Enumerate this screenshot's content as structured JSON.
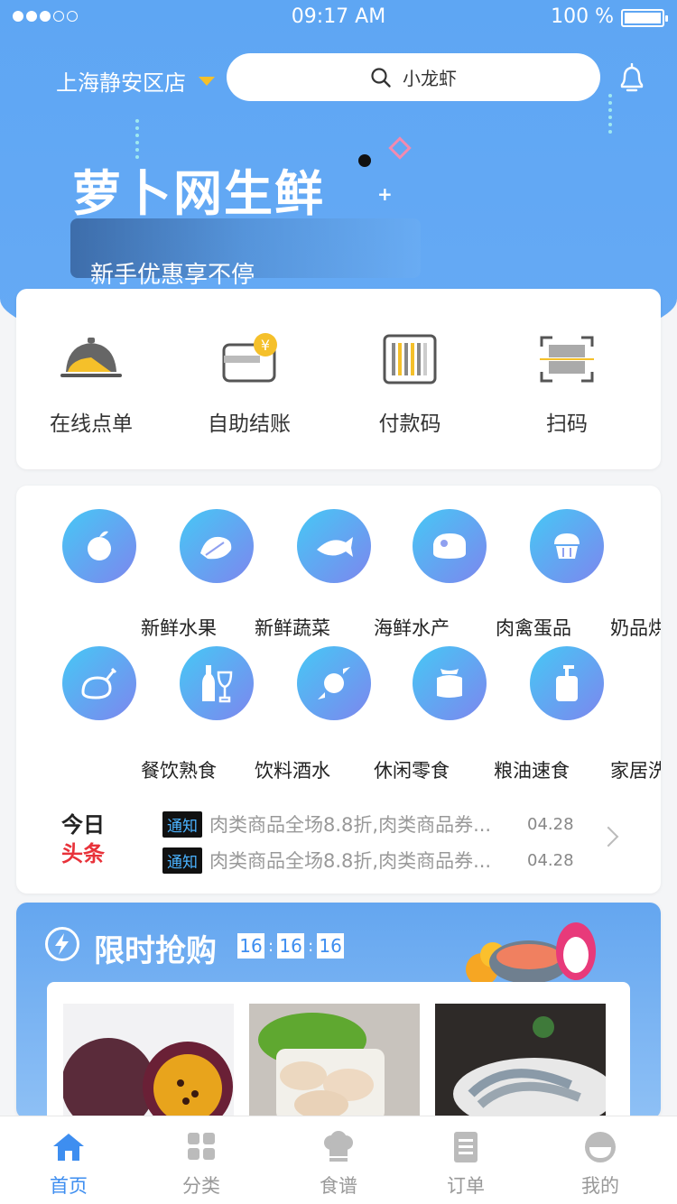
{
  "status_bar": {
    "time": "09:17 AM",
    "battery": "100 %"
  },
  "header": {
    "store_name": "上海静安区店",
    "search_text": "小龙虾"
  },
  "banner": {
    "title": "萝卜网生鲜",
    "subtitle": "新手优惠享不停"
  },
  "services": [
    {
      "label": "在线点单",
      "icon": "cloche-icon"
    },
    {
      "label": "自助结账",
      "icon": "yen-card-icon"
    },
    {
      "label": "付款码",
      "icon": "barcode-icon"
    },
    {
      "label": "扫码",
      "icon": "scan-icon"
    }
  ],
  "categories": [
    {
      "label": "新鲜水果",
      "icon": "fruit-icon"
    },
    {
      "label": "新鲜蔬菜",
      "icon": "vegetable-icon"
    },
    {
      "label": "海鲜水产",
      "icon": "fish-icon"
    },
    {
      "label": "肉禽蛋品",
      "icon": "meat-icon"
    },
    {
      "label": "奶品烘焙",
      "icon": "cake-icon"
    },
    {
      "label": "餐饮熟食",
      "icon": "chicken-icon"
    },
    {
      "label": "饮料酒水",
      "icon": "wine-icon"
    },
    {
      "label": "休闲零食",
      "icon": "candy-icon"
    },
    {
      "label": "粮油速食",
      "icon": "rice-bag-icon"
    },
    {
      "label": "家居洗护",
      "icon": "pump-bottle-icon"
    }
  ],
  "headlines": {
    "logo_line1": "今日",
    "logo_line2": "头条",
    "items": [
      {
        "tag": "通知",
        "text": "肉类商品全场8.8折,肉类商品券...",
        "date": "04.28"
      },
      {
        "tag": "通知",
        "text": "肉类商品全场8.8折,肉类商品券...",
        "date": "04.28"
      }
    ]
  },
  "flash_sale": {
    "title": "限时抢购",
    "hours": "16",
    "minutes": "16",
    "seconds": "16"
  },
  "tabs": [
    {
      "label": "首页",
      "active": true
    },
    {
      "label": "分类",
      "active": false
    },
    {
      "label": "食谱",
      "active": false
    },
    {
      "label": "订单",
      "active": false
    },
    {
      "label": "我的",
      "active": false
    }
  ],
  "colors": {
    "primary": "#3e8ef0",
    "hero_bg": "#5ea6f3",
    "accent_yellow": "#f5c02a",
    "notice_red": "#e8323a"
  }
}
